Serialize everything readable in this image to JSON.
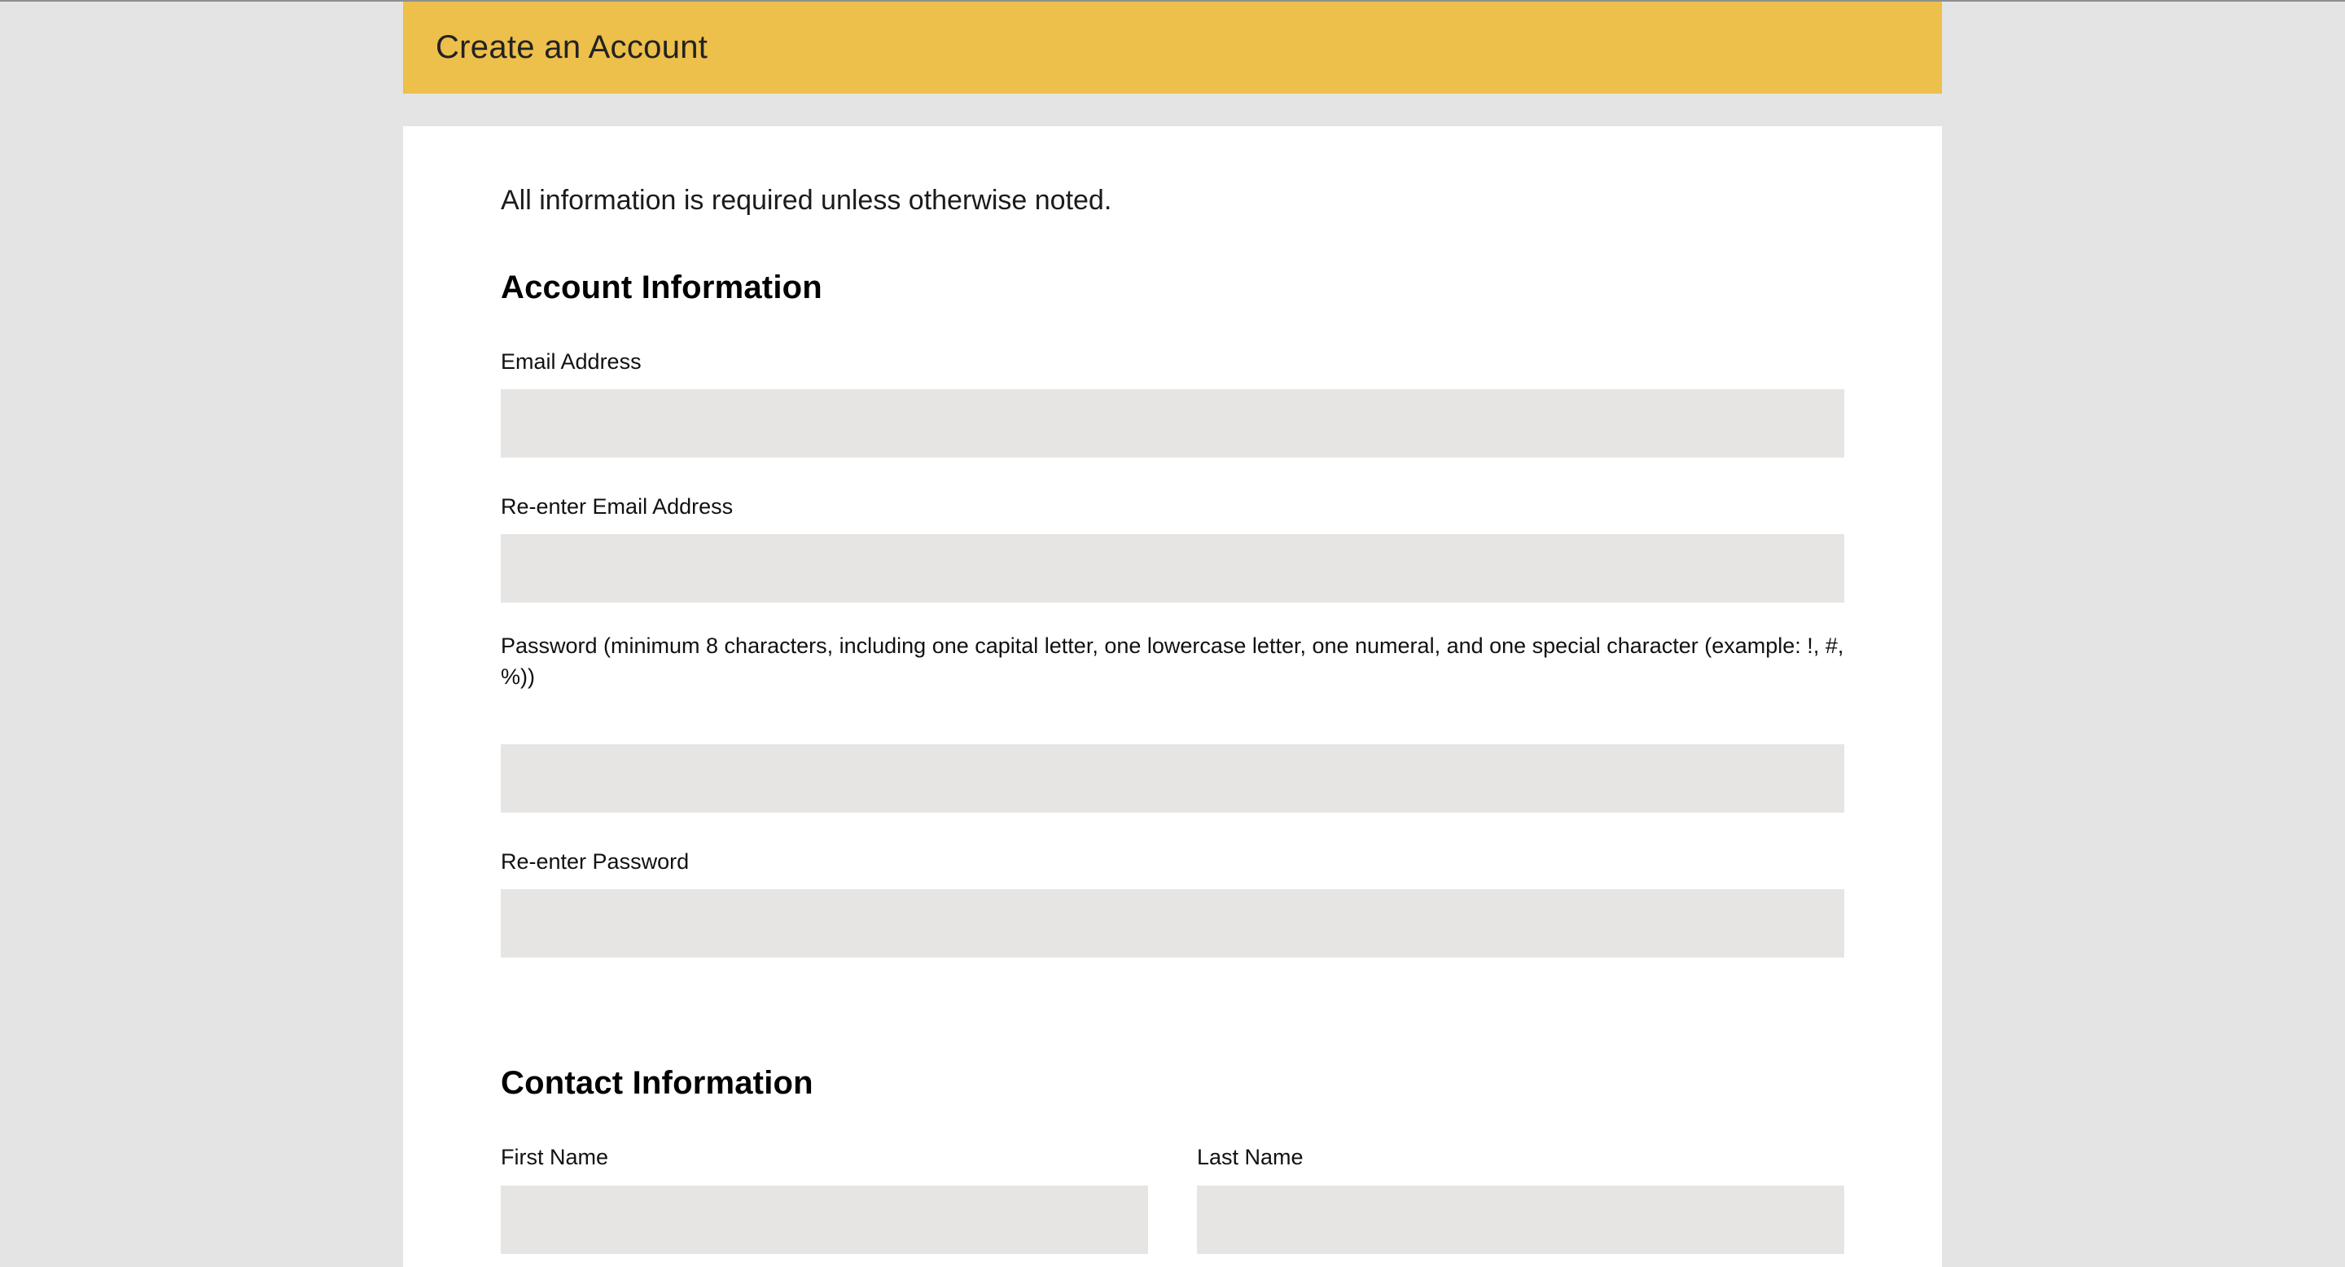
{
  "header": {
    "title": "Create an Account"
  },
  "form": {
    "intro": "All information is required unless otherwise noted.",
    "account_section": {
      "heading": "Account Information",
      "fields": {
        "email": {
          "label": "Email Address",
          "value": "",
          "placeholder": ""
        },
        "email_confirm": {
          "label": "Re-enter Email Address",
          "value": "",
          "placeholder": ""
        },
        "password": {
          "label": "Password (minimum 8 characters, including one capital letter, one lowercase letter, one numeral, and one special character (example: !, #, %))",
          "value": "",
          "placeholder": ""
        },
        "password_confirm": {
          "label": "Re-enter Password",
          "value": "",
          "placeholder": ""
        }
      }
    },
    "contact_section": {
      "heading": "Contact Information",
      "fields": {
        "first_name": {
          "label": "First Name",
          "value": "",
          "placeholder": ""
        },
        "last_name": {
          "label": "Last Name",
          "value": "",
          "placeholder": ""
        }
      }
    }
  },
  "colors": {
    "page_background": "#e4e4e4",
    "header_accent": "#edbf4b",
    "card_background": "#ffffff",
    "input_background": "#e6e5e3"
  }
}
